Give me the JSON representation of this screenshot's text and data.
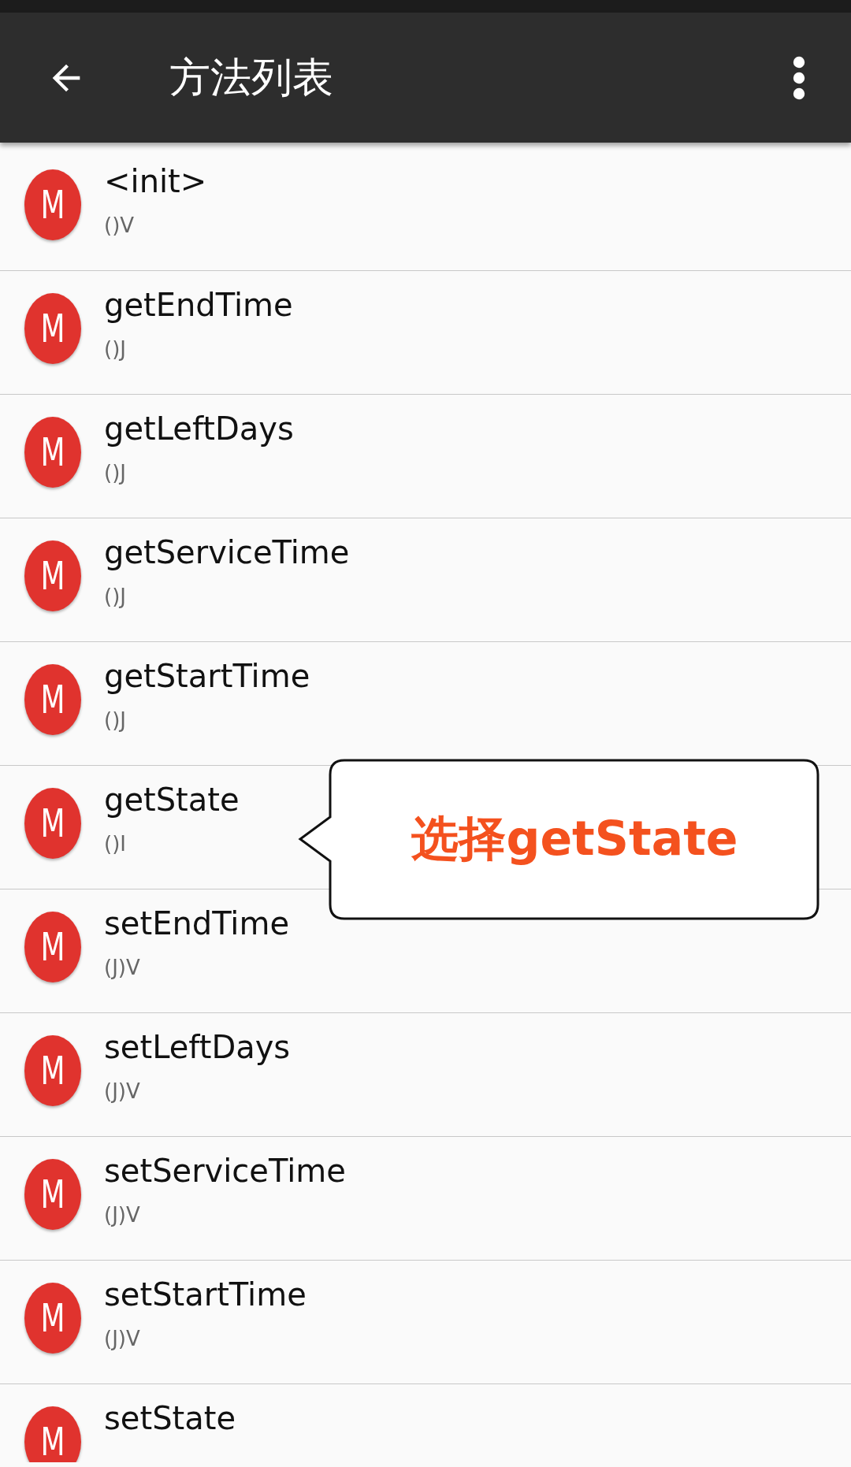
{
  "app_bar": {
    "title": "方法列表"
  },
  "methods": [
    {
      "badge": "M",
      "name": "<init>",
      "signature": "()V"
    },
    {
      "badge": "M",
      "name": "getEndTime",
      "signature": "()J"
    },
    {
      "badge": "M",
      "name": "getLeftDays",
      "signature": "()J"
    },
    {
      "badge": "M",
      "name": "getServiceTime",
      "signature": "()J"
    },
    {
      "badge": "M",
      "name": "getStartTime",
      "signature": "()J"
    },
    {
      "badge": "M",
      "name": "getState",
      "signature": "()I"
    },
    {
      "badge": "M",
      "name": "setEndTime",
      "signature": "(J)V"
    },
    {
      "badge": "M",
      "name": "setLeftDays",
      "signature": "(J)V"
    },
    {
      "badge": "M",
      "name": "setServiceTime",
      "signature": "(J)V"
    },
    {
      "badge": "M",
      "name": "setStartTime",
      "signature": "(J)V"
    },
    {
      "badge": "M",
      "name": "setState"
    }
  ],
  "callout": {
    "text": "选择getState"
  }
}
